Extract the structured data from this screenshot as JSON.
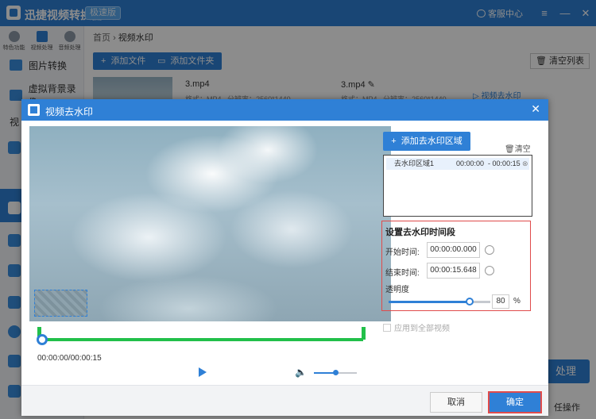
{
  "app": {
    "title": "迅捷视频转换器",
    "badge": "极速版",
    "service_label": "客服中心"
  },
  "window_controls": {
    "menu": "≡",
    "minimize": "—",
    "close": "✕"
  },
  "sidebar": {
    "top_tabs": [
      {
        "label": "特色功能"
      },
      {
        "label": "视频处理"
      },
      {
        "label": "音频处理"
      }
    ],
    "items": [
      {
        "label": "图片转换"
      },
      {
        "label": "虚拟背景录像"
      },
      {
        "label": "视"
      }
    ]
  },
  "breadcrumb": {
    "home": "首页",
    "sep": "›",
    "current": "视频水印"
  },
  "toolbar": {
    "add_file": "添加文件",
    "add_folder": "添加文件夹",
    "clear_list": "清空列表"
  },
  "files": [
    {
      "name": "3.mp4",
      "format_label": "格式：",
      "format": "MP4",
      "res_label": "分辨率：",
      "resolution": "2560*1440"
    },
    {
      "name": "3.mp4",
      "format_label": "格式：",
      "format": "MP4",
      "res_label": "分辨率：",
      "resolution": "2560*1440",
      "action": "视频去水印"
    }
  ],
  "background_buttons": {
    "process": "处理",
    "batch": "任操作"
  },
  "dialog": {
    "title": "视频去水印",
    "close": "✕",
    "add_region": "添加去水印区域",
    "clear": "清空",
    "regions": [
      {
        "name": "去水印区域1",
        "start": "00:00:00",
        "end": "00:00:15"
      }
    ],
    "time_section": {
      "title": "设置去水印时间段",
      "start_label": "开始时间:",
      "start_value": "00:00:00.000",
      "end_label": "结束时间:",
      "end_value": "00:00:15.648",
      "opacity_label": "透明度",
      "opacity_value": "80",
      "opacity_unit": "%",
      "opacity_level": 0.8
    },
    "apply_all": "应用到全部视频",
    "time_display": "00:00:00/00:00:15",
    "volume_level": 0.5,
    "cancel": "取消",
    "ok": "确定"
  },
  "colors": {
    "accent": "#2f80d6",
    "trim": "#22c04a",
    "highlight": "#e04b4b"
  }
}
